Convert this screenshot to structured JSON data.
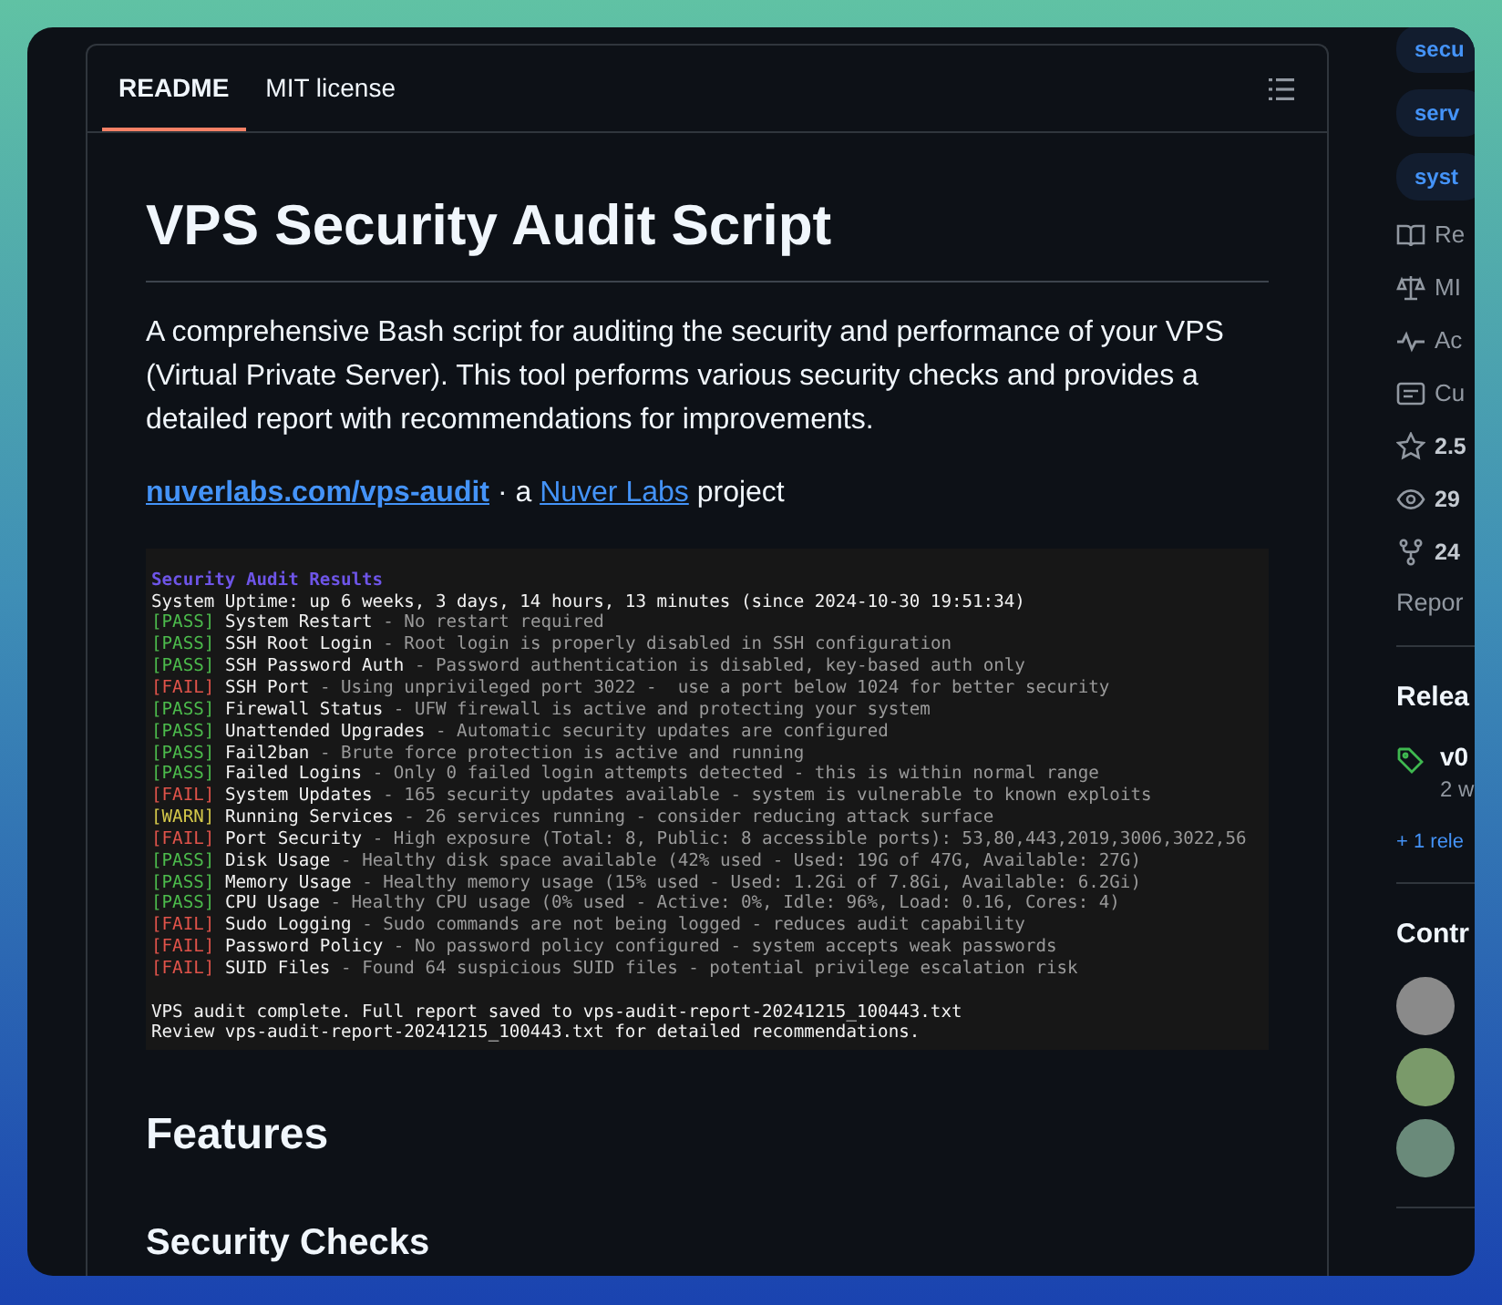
{
  "readme": {
    "tabs": [
      {
        "label": "README",
        "selected": true
      },
      {
        "label": "MIT license",
        "selected": false
      }
    ],
    "title": "VPS Security Audit Script",
    "intro": "A comprehensive Bash script for auditing the security and performance of your VPS (Virtual Private Server). This tool performs various security checks and provides a detailed report with recommendations for improvements.",
    "credit": {
      "site_link": "nuverlabs.com/vps-audit",
      "middle": " · a ",
      "org_link": "Nuver Labs",
      "suffix": " project"
    },
    "terminal": {
      "heading": "Security Audit Results",
      "uptime": "System Uptime: up 6 weeks, 3 days, 14 hours, 13 minutes (since 2024-10-30 19:51:34)",
      "checks": [
        {
          "status": "[PASS]",
          "kind": "pass",
          "name": "System Restart",
          "detail": "- No restart required"
        },
        {
          "status": "[PASS]",
          "kind": "pass",
          "name": "SSH Root Login",
          "detail": "- Root login is properly disabled in SSH configuration"
        },
        {
          "status": "[PASS]",
          "kind": "pass",
          "name": "SSH Password Auth",
          "detail": "- Password authentication is disabled, key-based auth only"
        },
        {
          "status": "[FAIL]",
          "kind": "fail",
          "name": "SSH Port",
          "detail": "- Using unprivileged port 3022 -  use a port below 1024 for better security"
        },
        {
          "status": "[PASS]",
          "kind": "pass",
          "name": "Firewall Status",
          "detail": "- UFW firewall is active and protecting your system"
        },
        {
          "status": "[PASS]",
          "kind": "pass",
          "name": "Unattended Upgrades",
          "detail": "- Automatic security updates are configured"
        },
        {
          "status": "[PASS]",
          "kind": "pass",
          "name": "Fail2ban",
          "detail": "- Brute force protection is active and running"
        },
        {
          "status": "[PASS]",
          "kind": "pass",
          "name": "Failed Logins",
          "detail": "- Only 0 failed login attempts detected - this is within normal range"
        },
        {
          "status": "[FAIL]",
          "kind": "fail",
          "name": "System Updates",
          "detail": "- 165 security updates available - system is vulnerable to known exploits"
        },
        {
          "status": "[WARN]",
          "kind": "warn",
          "name": "Running Services",
          "detail": "- 26 services running - consider reducing attack surface"
        },
        {
          "status": "[FAIL]",
          "kind": "fail",
          "name": "Port Security",
          "detail": "- High exposure (Total: 8, Public: 8 accessible ports): 53,80,443,2019,3006,3022,56"
        },
        {
          "status": "[PASS]",
          "kind": "pass",
          "name": "Disk Usage",
          "detail": "- Healthy disk space available (42% used - Used: 19G of 47G, Available: 27G)"
        },
        {
          "status": "[PASS]",
          "kind": "pass",
          "name": "Memory Usage",
          "detail": "- Healthy memory usage (15% used - Used: 1.2Gi of 7.8Gi, Available: 6.2Gi)"
        },
        {
          "status": "[PASS]",
          "kind": "pass",
          "name": "CPU Usage",
          "detail": "- Healthy CPU usage (0% used - Active: 0%, Idle: 96%, Load: 0.16, Cores: 4)"
        },
        {
          "status": "[FAIL]",
          "kind": "fail",
          "name": "Sudo Logging",
          "detail": "- Sudo commands are not being logged - reduces audit capability"
        },
        {
          "status": "[FAIL]",
          "kind": "fail",
          "name": "Password Policy",
          "detail": "- No password policy configured - system accepts weak passwords"
        },
        {
          "status": "[FAIL]",
          "kind": "fail",
          "name": "SUID Files",
          "detail": "- Found 64 suspicious SUID files - potential privilege escalation risk"
        }
      ],
      "footer": [
        "VPS audit complete. Full report saved to vps-audit-report-20241215_100443.txt",
        "Review vps-audit-report-20241215_100443.txt for detailed recommendations."
      ]
    },
    "features_heading": "Features",
    "subheading": "Security Checks"
  },
  "sidebar": {
    "topics": [
      "secu",
      "serv",
      "syst"
    ],
    "links": [
      {
        "kind": "book",
        "label": "Re"
      },
      {
        "kind": "scale",
        "label": "MI"
      },
      {
        "kind": "pulse",
        "label": "Ac"
      },
      {
        "kind": "conduct",
        "label": "Cu"
      },
      {
        "kind": "star",
        "label": "2.5"
      },
      {
        "kind": "eye",
        "label": "29"
      },
      {
        "kind": "fork",
        "label": "24"
      }
    ],
    "report": "Repor",
    "releases": {
      "heading": "Relea",
      "tag": "v0",
      "date": "2 w",
      "more": "+ 1 rele"
    },
    "contributors": {
      "heading": "Contr",
      "avatars": [
        {
          "color": "#8a8a8a"
        },
        {
          "color": "#7a9a6a"
        },
        {
          "color": "#6a8a7a"
        }
      ]
    }
  }
}
